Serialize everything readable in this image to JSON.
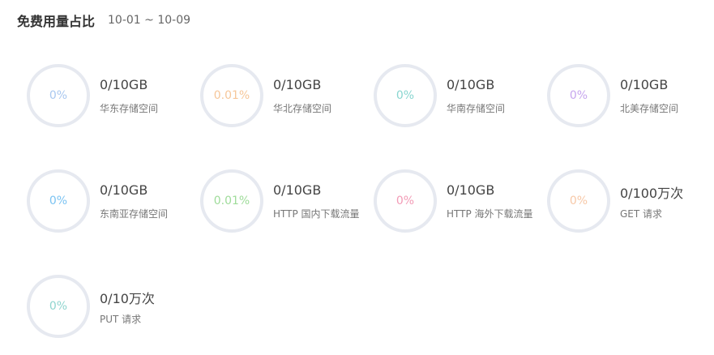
{
  "header": {
    "title": "免费用量占比",
    "date_range": "10-01 ~ 10-09"
  },
  "items": [
    {
      "percent": "0%",
      "value": "0/10GB",
      "label": "华东存储空间",
      "color": "#a9c8f0"
    },
    {
      "percent": "0.01%",
      "value": "0/10GB",
      "label": "华北存储空间",
      "color": "#f6c79a"
    },
    {
      "percent": "0%",
      "value": "0/10GB",
      "label": "华南存储空间",
      "color": "#89d6d0"
    },
    {
      "percent": "0%",
      "value": "0/10GB",
      "label": "北美存储空间",
      "color": "#c7a6ee"
    },
    {
      "percent": "0%",
      "value": "0/10GB",
      "label": "东南亚存储空间",
      "color": "#7bc3f2"
    },
    {
      "percent": "0.01%",
      "value": "0/10GB",
      "label": "HTTP 国内下载流量",
      "color": "#9fdc9a"
    },
    {
      "percent": "0%",
      "value": "0/10GB",
      "label": "HTTP 海外下载流量",
      "color": "#f29bb6"
    },
    {
      "percent": "0%",
      "value": "0/100万次",
      "label": "GET 请求",
      "color": "#f7c8a7"
    },
    {
      "percent": "0%",
      "value": "0/10万次",
      "label": "PUT 请求",
      "color": "#8fd5cf"
    }
  ]
}
